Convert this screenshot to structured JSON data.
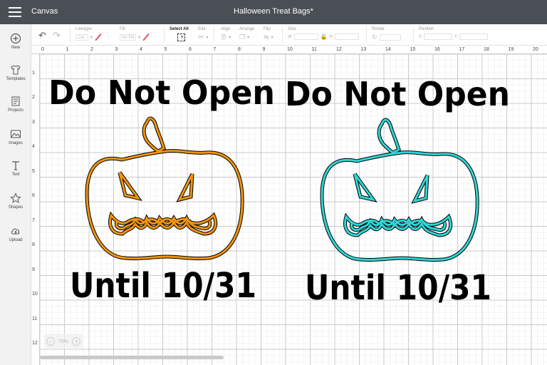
{
  "app": {
    "name": "Canvas",
    "document_title": "Halloween Treat Bags*"
  },
  "toolbar": {
    "undo_icon": "undo-icon",
    "redo_icon": "redo-icon",
    "linetype": {
      "label": "Linetype",
      "value": "Cut"
    },
    "fill": {
      "label": "Fill",
      "value": "No Fill"
    },
    "select_all": {
      "label": "Select All"
    },
    "edit": {
      "label": "Edit"
    },
    "align": {
      "label": "Align"
    },
    "arrange": {
      "label": "Arrange"
    },
    "flip": {
      "label": "Flip"
    },
    "size": {
      "label": "Size",
      "w_label": "W",
      "h_label": "H"
    },
    "rotate": {
      "label": "Rotate"
    },
    "position": {
      "label": "Position",
      "x_label": "X",
      "y_label": "Y"
    }
  },
  "sidebar": {
    "items": [
      {
        "label": "New",
        "icon": "plus-circle-icon"
      },
      {
        "label": "Templates",
        "icon": "shirt-icon"
      },
      {
        "label": "Projects",
        "icon": "projects-icon"
      },
      {
        "label": "Images",
        "icon": "image-icon"
      },
      {
        "label": "Text",
        "icon": "text-icon"
      },
      {
        "label": "Shapes",
        "icon": "shapes-icon"
      },
      {
        "label": "Upload",
        "icon": "upload-cloud-icon"
      }
    ]
  },
  "rulers": {
    "top": [
      "0",
      "1",
      "2",
      "3",
      "4",
      "5",
      "6",
      "7",
      "8",
      "9",
      "10",
      "11",
      "12",
      "13",
      "14",
      "15",
      "16",
      "17",
      "18",
      "19",
      "20"
    ],
    "left": [
      "1",
      "2",
      "3",
      "4",
      "5",
      "6",
      "7",
      "8",
      "9",
      "10",
      "11",
      "12"
    ]
  },
  "design": {
    "left_heading": "Do Not Open",
    "left_footer": "Until 10/31",
    "right_heading": "Do Not Open",
    "right_footer": "Until 10/31",
    "left_pumpkin_color": "#f0940f",
    "right_pumpkin_color": "#2fd6d6"
  },
  "zoom": {
    "value": "75%"
  },
  "colors": {
    "titlebar": "#4a4f55",
    "sidebar": "#f2f2f3"
  }
}
